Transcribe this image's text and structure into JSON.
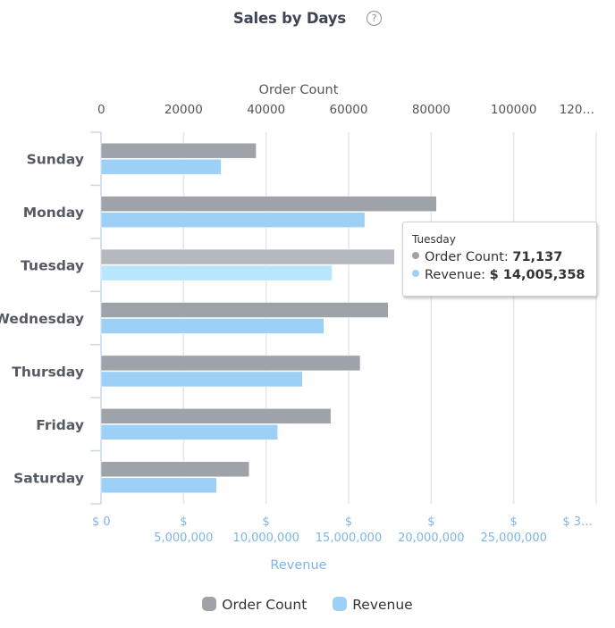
{
  "header": {
    "title": "Sales by Days",
    "help_icon": "question-circle-icon",
    "help_glyph": "?"
  },
  "colors": {
    "order_count": "#9ea2a9",
    "order_count_hover": "#b5b9bf",
    "revenue": "#9dd0f7",
    "revenue_hover": "#b8e6fc",
    "revenue_axis": "#7fb5e6",
    "gridline": "#e6e6e6",
    "category_axis": "#ccd6eb"
  },
  "tooltip": {
    "category": "Tuesday",
    "rows": [
      {
        "label": "Order Count:",
        "value": "71,137",
        "color": "#9ea2a9"
      },
      {
        "label": "Revenue:",
        "value": "$ 14,005,358",
        "color": "#9dd0f7"
      }
    ]
  },
  "legend": [
    {
      "label": "Order Count",
      "color": "#9ea2a9"
    },
    {
      "label": "Revenue",
      "color": "#9dd0f7"
    }
  ],
  "chart_data": {
    "type": "bar",
    "orientation": "horizontal",
    "title": "Sales by Days",
    "categories": [
      "Sunday",
      "Monday",
      "Tuesday",
      "Wednesday",
      "Thursday",
      "Friday",
      "Saturday"
    ],
    "highlighted_category": "Tuesday",
    "series": [
      {
        "name": "Order Count",
        "axis": "top",
        "values": [
          37600,
          81300,
          71137,
          69600,
          62800,
          55700,
          35900
        ]
      },
      {
        "name": "Revenue",
        "axis": "bottom",
        "values": [
          7280000,
          15980000,
          14005358,
          13500000,
          12200000,
          10700000,
          7000000
        ]
      }
    ],
    "axes": {
      "top": {
        "title": "Order Count",
        "range": [
          0,
          120000
        ],
        "ticks": [
          0,
          20000,
          40000,
          60000,
          80000,
          100000,
          120000
        ],
        "tick_labels": [
          "0",
          "20000",
          "40000",
          "60000",
          "80000",
          "100000",
          "120…"
        ]
      },
      "bottom": {
        "title": "Revenue",
        "range": [
          0,
          30000000
        ],
        "ticks": [
          0,
          5000000,
          10000000,
          15000000,
          20000000,
          25000000,
          30000000
        ],
        "tick_labels": [
          [
            "$ 0"
          ],
          [
            "$",
            "5,000,000"
          ],
          [
            "$",
            "10,000,000"
          ],
          [
            "$",
            "15,000,000"
          ],
          [
            "$",
            "20,000,000"
          ],
          [
            "$",
            "25,000,000"
          ],
          [
            "$ 3…"
          ]
        ]
      }
    },
    "grid": true,
    "legend_position": "bottom-center"
  }
}
